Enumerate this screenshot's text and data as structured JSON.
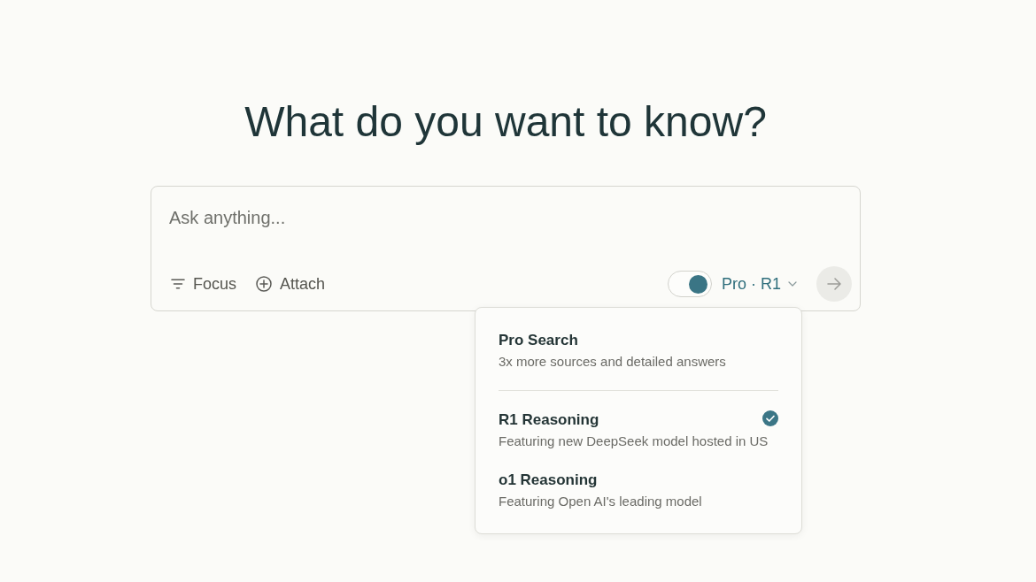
{
  "heading": "What do you want to know?",
  "search": {
    "placeholder": "Ask anything...",
    "tools": [
      {
        "kind": "focus",
        "label": "Focus"
      },
      {
        "kind": "attach",
        "label": "Attach"
      }
    ],
    "pro_toggle": {
      "on": true
    },
    "model_button": {
      "label": "Pro · R1"
    },
    "submit_button": {
      "disabled": true
    }
  },
  "model_menu": {
    "sections": [
      {
        "items": [
          {
            "title": "Pro Search",
            "description": "3x more sources and detailed answers",
            "selected": false
          }
        ]
      },
      {
        "items": [
          {
            "title": "R1 Reasoning",
            "description": "Featuring new DeepSeek model hosted in US",
            "selected": true
          },
          {
            "title": "o1 Reasoning",
            "description": "Featuring Open AI's leading model",
            "selected": false
          }
        ]
      }
    ]
  }
}
